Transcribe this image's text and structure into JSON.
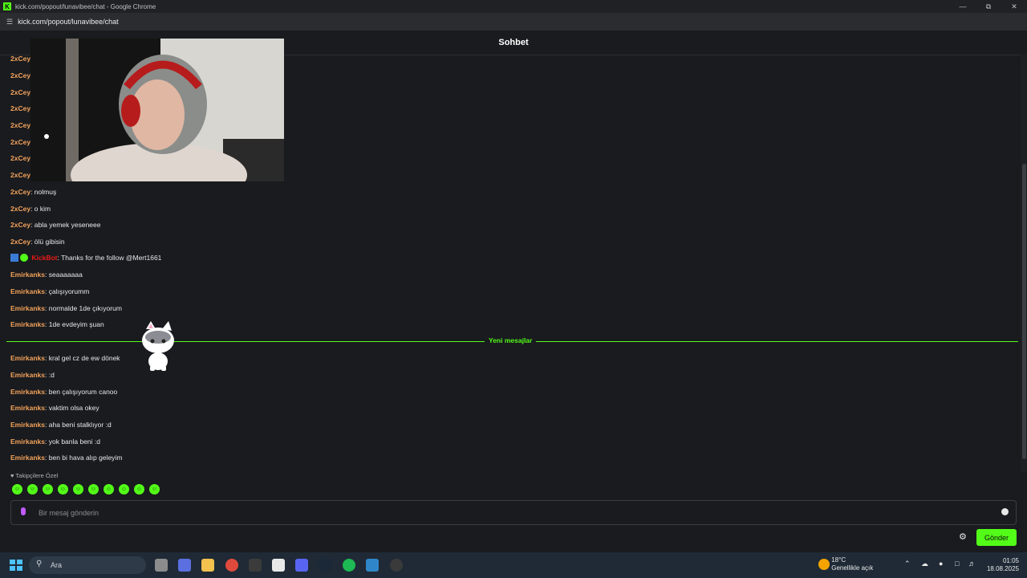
{
  "window": {
    "title": "kick.com/popout/lunavibee/chat - Google Chrome",
    "url": "kick.com/popout/lunavibee/chat"
  },
  "header": {
    "title": "Sohbet"
  },
  "messages": [
    {
      "user": "2xCey",
      "text": ""
    },
    {
      "user": "2xCey",
      "text": ""
    },
    {
      "user": "2xCey",
      "text": ""
    },
    {
      "user": "2xCey",
      "text": ""
    },
    {
      "user": "2xCey",
      "text": ""
    },
    {
      "user": "2xCey",
      "text": ""
    },
    {
      "user": "2xCey",
      "text": ""
    },
    {
      "user": "2xCey",
      "text": ""
    },
    {
      "user": "2xCey",
      "text": "nolmuş"
    },
    {
      "user": "2xCey",
      "text": "o kim"
    },
    {
      "user": "2xCey",
      "text": "abla yemek yeseneee"
    },
    {
      "user": "2xCey",
      "text": "ölü gibisin"
    },
    {
      "user": "KickBot",
      "text": "Thanks for the follow @Mert1661",
      "bot": true
    },
    {
      "user": "Emirkanks",
      "text": "seaaaaaaa"
    },
    {
      "user": "Emirkanks",
      "text": "çalışıyorumm"
    },
    {
      "user": "Emirkanks",
      "text": "normalde 1de çıkıyorum"
    },
    {
      "user": "Emirkanks",
      "text": "1de evdeyim şuan"
    },
    {
      "user": "Emirkanks",
      "text": "kral gel cz de ew dönek"
    },
    {
      "user": "Emirkanks",
      "text": ":d"
    },
    {
      "user": "Emirkanks",
      "text": "ben çalışıyorum canoo"
    },
    {
      "user": "Emirkanks",
      "text": "vaktim olsa okey"
    },
    {
      "user": "Emirkanks",
      "text": "aha beni stalklıyor :d"
    },
    {
      "user": "Emirkanks",
      "text": "yok banla beni :d"
    },
    {
      "user": "Emirkanks",
      "text": "ben bi hava alıp geleyim"
    }
  ],
  "divider": {
    "label": "Yeni mesajlar"
  },
  "followers": {
    "label": "Takipçilere Özel"
  },
  "input": {
    "placeholder": "Bir mesaj gönderin"
  },
  "send_label": "Gönder",
  "taskbar": {
    "search_label": "Ara",
    "temp": "18°C",
    "weather_desc": "Genellikle açık",
    "time": "01:05",
    "date": "18.08.2025"
  },
  "colors": {
    "accent": "#53fc18",
    "username": "#f4a35a",
    "bot": "#e91916",
    "background": "#191b1f"
  }
}
